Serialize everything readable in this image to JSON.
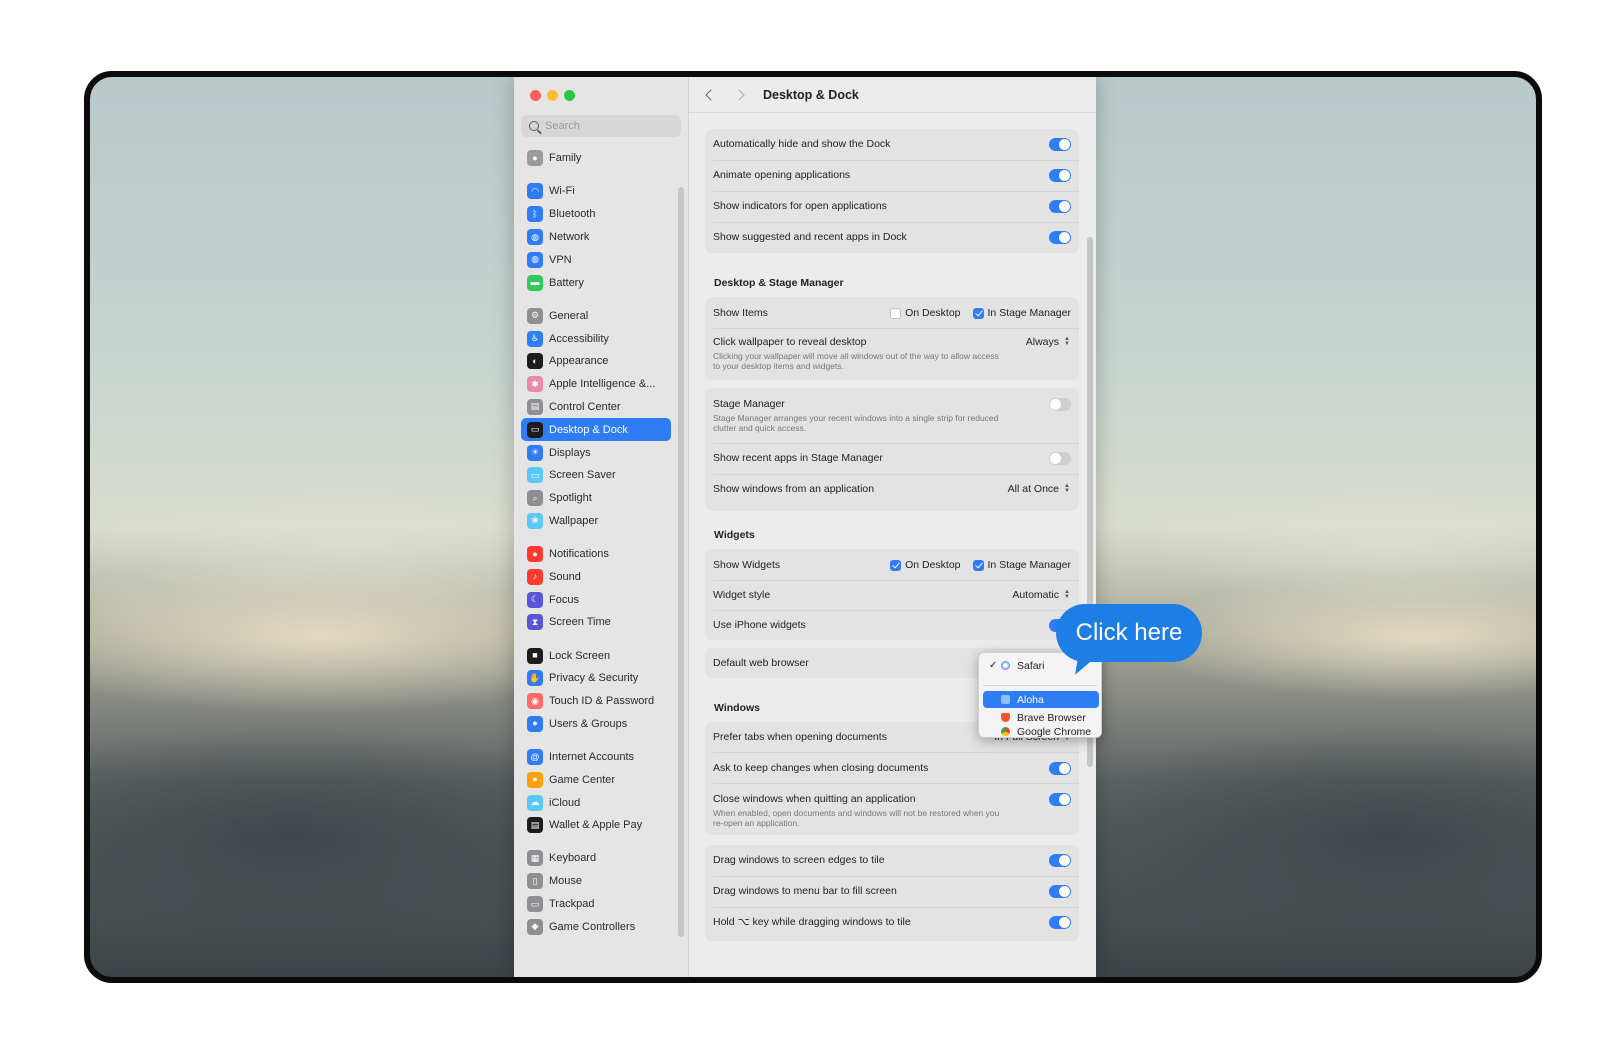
{
  "window": {
    "title": "Desktop & Dock",
    "search_placeholder": "Search"
  },
  "sidebar": {
    "items": [
      {
        "label": "Family",
        "icon": "family-icon",
        "color": "#9b9b9b"
      },
      {
        "label": "Wi-Fi",
        "icon": "wifi-icon",
        "color": "#2e7cf6"
      },
      {
        "label": "Bluetooth",
        "icon": "bluetooth-icon",
        "color": "#2e7cf6"
      },
      {
        "label": "Network",
        "icon": "globe-icon",
        "color": "#2e7cf6"
      },
      {
        "label": "VPN",
        "icon": "vpn-icon",
        "color": "#2e7cf6"
      },
      {
        "label": "Battery",
        "icon": "battery-icon",
        "color": "#34c759"
      },
      {
        "label": "General",
        "icon": "gear-icon",
        "color": "#8e8e93"
      },
      {
        "label": "Accessibility",
        "icon": "accessibility-icon",
        "color": "#2e7cf6"
      },
      {
        "label": "Appearance",
        "icon": "appearance-icon",
        "color": "#1c1c1e"
      },
      {
        "label": "Apple Intelligence &...",
        "icon": "apple-intelligence-icon",
        "color": "#e88aa8"
      },
      {
        "label": "Control Center",
        "icon": "control-center-icon",
        "color": "#8e8e93"
      },
      {
        "label": "Desktop & Dock",
        "icon": "dock-icon",
        "color": "#1c1c1e"
      },
      {
        "label": "Displays",
        "icon": "sun-icon",
        "color": "#2e7cf6"
      },
      {
        "label": "Screen Saver",
        "icon": "screen-saver-icon",
        "color": "#5ac8fa"
      },
      {
        "label": "Spotlight",
        "icon": "magnifier-icon",
        "color": "#8e8e93"
      },
      {
        "label": "Wallpaper",
        "icon": "wallpaper-icon",
        "color": "#5ac8fa"
      },
      {
        "label": "Notifications",
        "icon": "bell-icon",
        "color": "#ff3b30"
      },
      {
        "label": "Sound",
        "icon": "speaker-icon",
        "color": "#ff3b30"
      },
      {
        "label": "Focus",
        "icon": "moon-icon",
        "color": "#5856d6"
      },
      {
        "label": "Screen Time",
        "icon": "hourglass-icon",
        "color": "#5856d6"
      },
      {
        "label": "Lock Screen",
        "icon": "lock-icon",
        "color": "#1c1c1e"
      },
      {
        "label": "Privacy & Security",
        "icon": "hand-icon",
        "color": "#2e7cf6"
      },
      {
        "label": "Touch ID & Password",
        "icon": "fingerprint-icon",
        "color": "#ff6b6b"
      },
      {
        "label": "Users & Groups",
        "icon": "users-icon",
        "color": "#2e7cf6"
      },
      {
        "label": "Internet Accounts",
        "icon": "at-icon",
        "color": "#2e7cf6"
      },
      {
        "label": "Game Center",
        "icon": "game-center-icon",
        "color": "#ff9f0a"
      },
      {
        "label": "iCloud",
        "icon": "cloud-icon",
        "color": "#5ac8fa"
      },
      {
        "label": "Wallet & Apple Pay",
        "icon": "wallet-icon",
        "color": "#1c1c1e"
      },
      {
        "label": "Keyboard",
        "icon": "keyboard-icon",
        "color": "#8e8e93"
      },
      {
        "label": "Mouse",
        "icon": "mouse-icon",
        "color": "#8e8e93"
      },
      {
        "label": "Trackpad",
        "icon": "trackpad-icon",
        "color": "#8e8e93"
      },
      {
        "label": "Game Controllers",
        "icon": "gamepad-icon",
        "color": "#8e8e93"
      }
    ],
    "active": "Desktop & Dock"
  },
  "dock": {
    "auto_hide": "Automatically hide and show the Dock",
    "animate": "Animate opening applications",
    "indicators": "Show indicators for open applications",
    "suggested": "Show suggested and recent apps in Dock"
  },
  "stage": {
    "title": "Desktop & Stage Manager",
    "show_items": "Show Items",
    "on_desktop": "On Desktop",
    "in_stage_manager": "In Stage Manager",
    "click_wallpaper": "Click wallpaper to reveal desktop",
    "click_wallpaper_desc": "Clicking your wallpaper will move all windows out of the way to allow access to your desktop items and widgets.",
    "click_wallpaper_value": "Always",
    "stage_manager": "Stage Manager",
    "stage_manager_desc": "Stage Manager arranges your recent windows into a single strip for reduced clutter and quick access.",
    "recent_apps": "Show recent apps in Stage Manager",
    "show_windows": "Show windows from an application",
    "show_windows_value": "All at Once"
  },
  "widgets": {
    "title": "Widgets",
    "show_widgets": "Show Widgets",
    "on_desktop": "On Desktop",
    "in_stage_manager": "In Stage Manager",
    "style": "Widget style",
    "style_value": "Automatic",
    "iphone": "Use iPhone widgets",
    "browser": "Default web browser"
  },
  "windows": {
    "title": "Windows",
    "prefer_tabs": "Prefer tabs when opening documents",
    "prefer_tabs_value": "In Full Screen",
    "ask_keep": "Ask to keep changes when closing documents",
    "close_quit": "Close windows when quitting an application",
    "close_quit_desc": "When enabled, open documents and windows will not be restored when you re-open an application.",
    "drag_edges": "Drag windows to screen edges to tile",
    "drag_menu": "Drag windows to menu bar to fill screen",
    "hold_key": "Hold ⌥ key while dragging windows to tile"
  },
  "browser_menu": {
    "checked": "Safari",
    "items": [
      "Safari",
      "Aloha",
      "Brave Browser",
      "Google Chrome"
    ],
    "highlighted": "Aloha"
  },
  "callout": {
    "text": "Click here"
  },
  "colors": {
    "accent": "#2e7cf6",
    "callout": "#1f7ee6"
  }
}
